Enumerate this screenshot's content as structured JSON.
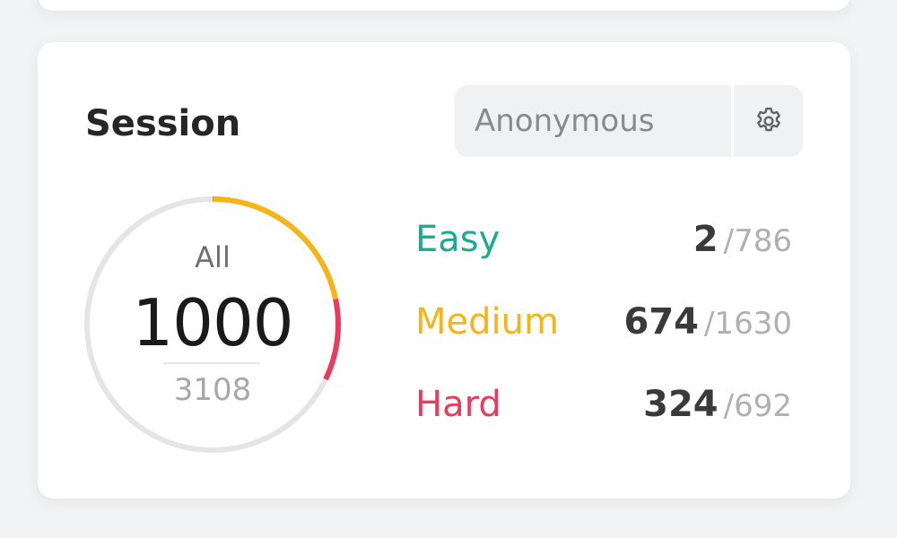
{
  "session": {
    "title": "Session",
    "user": "Anonymous",
    "settings_icon": "gear-icon"
  },
  "progress": {
    "label": "All",
    "solved": "1000",
    "total": "3108"
  },
  "difficulties": [
    {
      "name": "Easy",
      "solved": "2",
      "total": "/786",
      "color": "#1eaa8e"
    },
    {
      "name": "Medium",
      "solved": "674",
      "total": "/1630",
      "color": "#f5b518"
    },
    {
      "name": "Hard",
      "solved": "324",
      "total": "/692",
      "color": "#ea3a5e"
    }
  ],
  "ring": {
    "track_color": "#e5e5e5",
    "segments": [
      {
        "name": "Easy",
        "value": 2,
        "color": "#1eaa8e"
      },
      {
        "name": "Medium",
        "value": 674,
        "color": "#f5b518"
      },
      {
        "name": "Hard",
        "value": 324,
        "color": "#ea3a5e"
      }
    ],
    "denominator": 3108
  }
}
